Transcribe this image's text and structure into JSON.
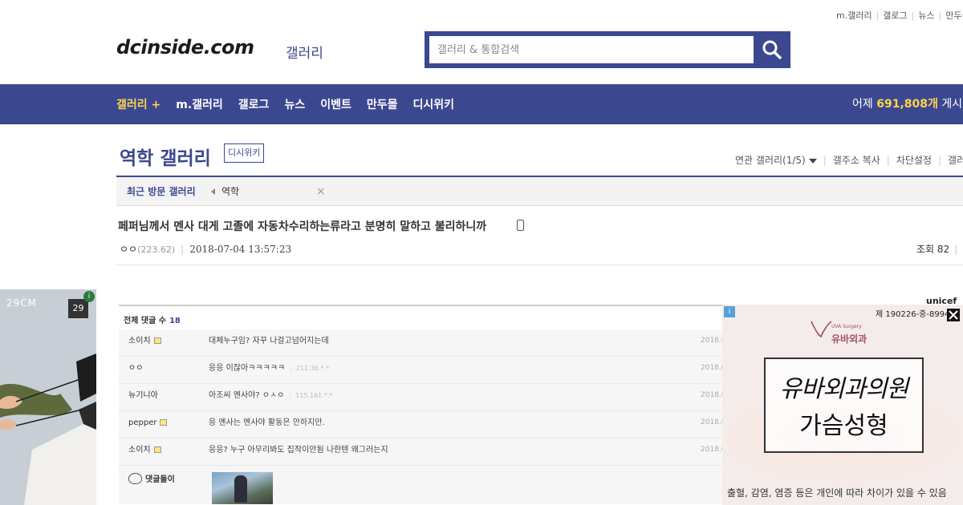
{
  "top_links": [
    "m.갤러리",
    "갤로그",
    "뉴스",
    "만두몰"
  ],
  "header": {
    "logo": "dcinside.com",
    "logo_sub": "갤러리",
    "search_placeholder": "갤러리 & 통합검색",
    "search_icon": "search-icon"
  },
  "nav": {
    "items": [
      "갤러리 +",
      "m.갤러리",
      "갤로그",
      "뉴스",
      "이벤트",
      "만두몰",
      "디시위키"
    ],
    "stat_prefix": "어제",
    "stat_value": "691,808개",
    "stat_suffix": "게시글"
  },
  "gallery": {
    "title": "역학 갤러리",
    "wiki_badge": "디시위키",
    "links": [
      "연관 갤러리(1/5)",
      "갤주소 복사",
      "차단설정",
      "갤러"
    ]
  },
  "recent": {
    "label": "최근 방문 갤러리",
    "item": "역학",
    "close": "×"
  },
  "post": {
    "title": "페퍼님께서 멘사 대게 고졸에 자동차수리하는류라고 분명히 말하고 불리하니까",
    "author": "ㅇㅇ",
    "ip": "(223.62)",
    "date": "2018-07-04 13:57:23",
    "views_label": "조회 82"
  },
  "left_ad": {
    "brand": "29CM",
    "badge": "29",
    "info": "i"
  },
  "comments": {
    "header_label": "전체 댓글 수",
    "count": "18",
    "rows": [
      {
        "nick": "소이치",
        "text": "대체누구임? 자꾸 나걸고넘어지는데",
        "ip": "",
        "date": "2018.0"
      },
      {
        "nick": "ㅇㅇ",
        "text": "응응 이잖아ㅋㅋㅋㅋㅋ",
        "ip": "211.36.*.*",
        "date": "2018.0"
      },
      {
        "nick": "뉴기니아",
        "text": "아조씨 멘사야? ㅇㅅㅇ",
        "ip": "115.161.*.*",
        "date": "2018.0"
      },
      {
        "nick": "pepper",
        "text": "응 멘사는 멘사야 활동은 안하지만.",
        "ip": "",
        "date": "2018.0"
      },
      {
        "nick": "소이치",
        "text": "응응? 누구 아무리봐도 집작이안됨 나한텐 왜그러는지",
        "ip": "",
        "date": "2018.0"
      }
    ],
    "bot_name": "댓글돌이"
  },
  "right_ad": {
    "info": "i",
    "reg": "제 190226-중-8994",
    "unicef": "unicef",
    "clinic_sub": "UVA Surgery",
    "clinic_name": "유바외과",
    "hand_text": "유바외과의원",
    "main_text": "가슴성형",
    "disclaimer": "출혈, 감염, 염증 등은 개인에 따라 차이가 있을 수 있음"
  },
  "colors": {
    "brand": "#3b4890",
    "accent": "#ffd54a"
  }
}
